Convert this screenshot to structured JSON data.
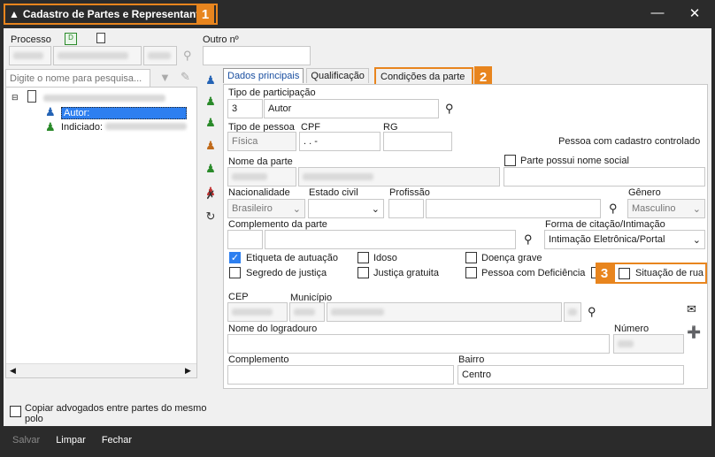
{
  "window": {
    "title": "Cadastro de Partes e Representantes",
    "callout1": "1"
  },
  "header": {
    "processo_label": "Processo",
    "outro_label": "Outro nº"
  },
  "search": {
    "placeholder": "Digite o nome para pesquisa..."
  },
  "tree": {
    "autor": "Autor:",
    "indiciado": "Indiciado:"
  },
  "tabs": [
    {
      "label": "Dados principais"
    },
    {
      "label": "Qualificação"
    },
    {
      "label": "Condições da parte"
    }
  ],
  "callout2": "2",
  "callout3": "3",
  "form": {
    "tipo_participacao_label": "Tipo de participação",
    "tipo_participacao_code": "3",
    "tipo_participacao_value": "Autor",
    "tipo_pessoa_label": "Tipo de pessoa",
    "tipo_pessoa_value": "Física",
    "cpf_label": "CPF",
    "cpf_value": ". . -",
    "rg_label": "RG",
    "cadastro_controlado": "Pessoa com cadastro controlado",
    "nome_label": "Nome da parte",
    "nome_social_label": "Parte possui nome social",
    "nacionalidade_label": "Nacionalidade",
    "nacionalidade_value": "Brasileiro",
    "estado_civil_label": "Estado civil",
    "profissao_label": "Profissão",
    "genero_label": "Gênero",
    "genero_value": "Masculino",
    "complemento_parte_label": "Complemento da parte",
    "forma_citacao_label": "Forma de citação/Intimação",
    "forma_citacao_value": "Intimação Eletrônica/Portal",
    "checks": {
      "etiqueta": "Etiqueta de autuação",
      "idoso": "Idoso",
      "doenca": "Doença grave",
      "segredo": "Segredo de justiça",
      "justica_gratuita": "Justiça gratuita",
      "deficiencia": "Pessoa com Deficiência",
      "situacao_rua": "Situação de rua"
    },
    "cep_label": "CEP",
    "municipio_label": "Município",
    "logradouro_label": "Nome do logradouro",
    "numero_label": "Número",
    "complemento_label": "Complemento",
    "bairro_label": "Bairro",
    "bairro_value": "Centro"
  },
  "copy_lawyers": "Copiar advogados entre partes do mesmo polo",
  "footer": {
    "salvar": "Salvar",
    "limpar": "Limpar",
    "fechar": "Fechar"
  },
  "colors": {
    "accent": "#e8851e",
    "selection": "#2d7ff0",
    "dark": "#2b2b2b"
  }
}
